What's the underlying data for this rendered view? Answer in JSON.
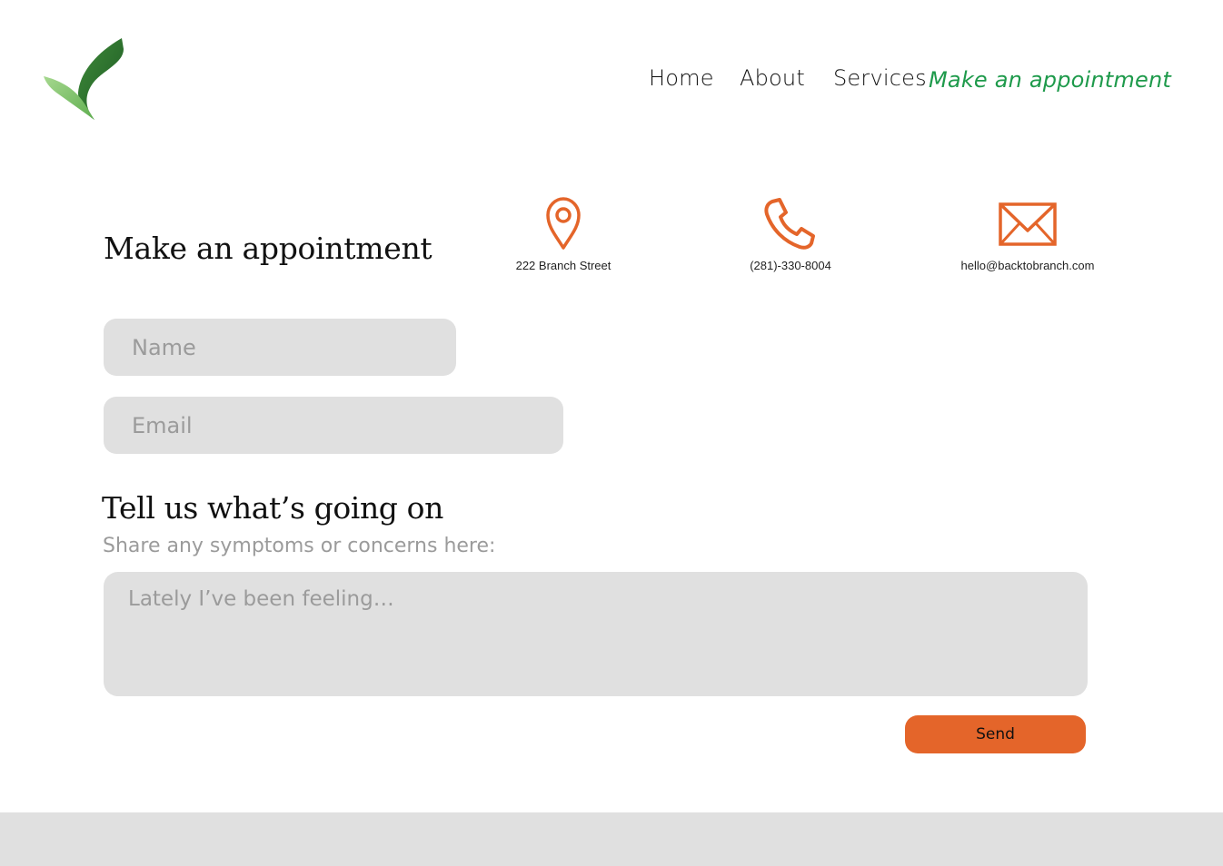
{
  "colors": {
    "accent_green": "#1e9a4b",
    "accent_orange": "#e4652a",
    "field_bg": "#e0e0e0",
    "placeholder": "#9b9b9b"
  },
  "logo": {
    "icon": "leaf-logo-icon"
  },
  "nav": {
    "items": [
      {
        "label": "Home",
        "active": false
      },
      {
        "label": "About",
        "active": false
      },
      {
        "label": "Services",
        "active": false
      },
      {
        "label": "Make an appointment",
        "active": true
      }
    ]
  },
  "main": {
    "title": "Make an appointment",
    "contacts": [
      {
        "icon": "map-pin-icon",
        "label": "222 Branch Street"
      },
      {
        "icon": "phone-icon",
        "label": "(281)-330-8004"
      },
      {
        "icon": "envelope-icon",
        "label": "hello@backtobranch.com"
      }
    ],
    "form": {
      "name_placeholder": "Name",
      "email_placeholder": "Email",
      "section_heading": "Tell us what’s going on",
      "section_subheading": "Share any symptoms or concerns here:",
      "message_placeholder": "Lately I’ve been feeling…",
      "send_label": "Send"
    }
  }
}
